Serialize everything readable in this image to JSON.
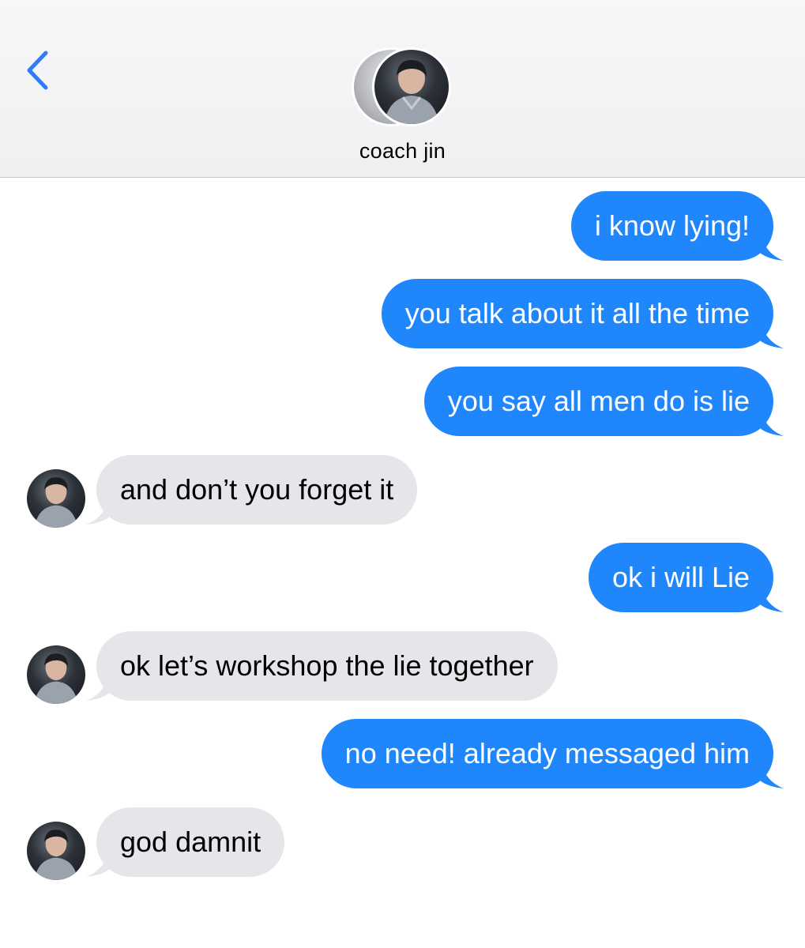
{
  "header": {
    "contact_name": "coach jin",
    "back_icon": "chevron-left-icon"
  },
  "colors": {
    "outgoing_bubble": "#1f86fb",
    "incoming_bubble": "#e6e5ea",
    "back_icon": "#2f7cf6"
  },
  "messages": [
    {
      "direction": "out",
      "text": "i know lying!"
    },
    {
      "direction": "out",
      "text": "you talk about it all the time"
    },
    {
      "direction": "out",
      "text": "you say all men do is lie"
    },
    {
      "direction": "in",
      "text": "and don’t you forget it"
    },
    {
      "direction": "out",
      "text": "ok i will Lie"
    },
    {
      "direction": "in",
      "text": "ok let’s workshop the lie together"
    },
    {
      "direction": "out",
      "text": "no need! already messaged him"
    },
    {
      "direction": "in",
      "text": "god damnit"
    }
  ]
}
